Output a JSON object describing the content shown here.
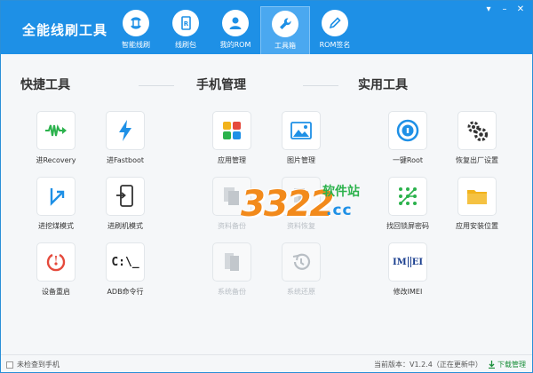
{
  "app": {
    "title": "全能线刷工具"
  },
  "window_controls": {
    "minimize": "▾",
    "restore": "–",
    "close": "✕"
  },
  "nav": [
    {
      "label": "智能线刷",
      "icon": "refresh-icon"
    },
    {
      "label": "线刷包",
      "icon": "package-icon"
    },
    {
      "label": "我的ROM",
      "icon": "user-icon"
    },
    {
      "label": "工具箱",
      "icon": "wrench-icon",
      "active": true
    },
    {
      "label": "ROM签名",
      "icon": "pen-icon"
    }
  ],
  "sections": {
    "quick": {
      "title": "快捷工具"
    },
    "phone": {
      "title": "手机管理"
    },
    "util": {
      "title": "实用工具"
    }
  },
  "tiles": {
    "recovery": {
      "label": "进Recovery",
      "icon": "recovery-wave-icon",
      "color": "#2bb24c"
    },
    "fastboot": {
      "label": "进Fastboot",
      "icon": "lightning-icon",
      "color": "#1e90e6"
    },
    "edl": {
      "label": "进挖煤模式",
      "icon": "arrow-turn-icon",
      "color": "#1e90e6"
    },
    "download": {
      "label": "进刷机模式",
      "icon": "phone-enter-icon",
      "color": "#333333"
    },
    "reboot": {
      "label": "设备重启",
      "icon": "reboot-icon",
      "color": "#e54a3c"
    },
    "adb": {
      "label": "ADB命令行",
      "icon": "terminal-icon",
      "text": "C:\\_"
    },
    "apps": {
      "label": "应用管理",
      "icon": "app-grid-icon"
    },
    "pictures": {
      "label": "图片管理",
      "icon": "picture-icon",
      "color": "#1e90e6"
    },
    "data_backup": {
      "label": "资料备份",
      "icon": "files-icon"
    },
    "data_restore": {
      "label": "资料恢复",
      "icon": "files-restore-icon"
    },
    "sys_backup": {
      "label": "系统备份",
      "icon": "copy-icon"
    },
    "sys_restore": {
      "label": "系统还原",
      "icon": "history-icon"
    },
    "root": {
      "label": "一键Root",
      "icon": "lock-circle-icon",
      "color": "#1e90e6"
    },
    "factory": {
      "label": "恢复出厂设置",
      "icon": "gears-icon",
      "color": "#333333"
    },
    "pattern": {
      "label": "找回锁屏密码",
      "icon": "pattern-lock-icon",
      "color": "#2bb24c"
    },
    "install_loc": {
      "label": "应用安装位置",
      "icon": "folder-icon",
      "color": "#f2b31b"
    },
    "imei": {
      "label": "修改IMEI",
      "icon": "imei-icon",
      "text_left": "IM",
      "text_right": "EI"
    }
  },
  "watermark": {
    "number": "3322",
    "site": "软件站",
    "domain": ".cc"
  },
  "status": {
    "device": "未检查到手机",
    "version": "当前版本：V1.2.4（正在更新中）",
    "download": "下载管理"
  }
}
